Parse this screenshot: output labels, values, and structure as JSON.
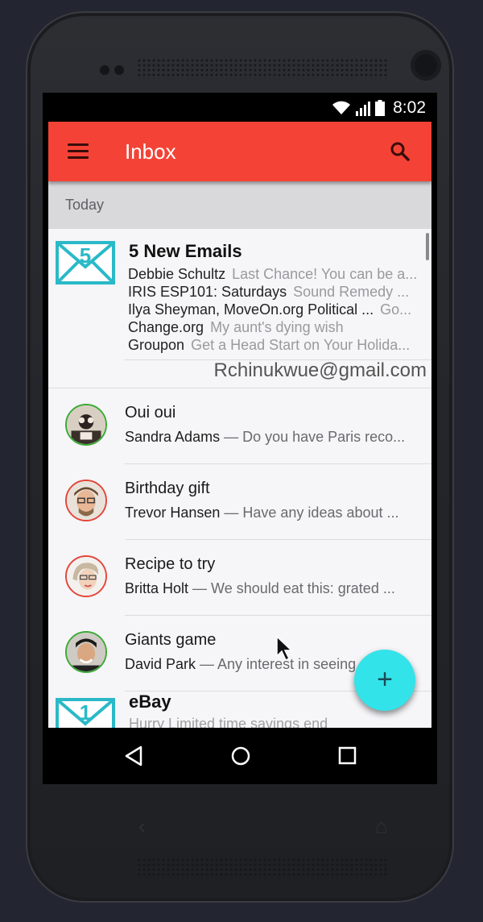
{
  "status_bar": {
    "time": "8:02"
  },
  "app_bar": {
    "title": "Inbox",
    "menu_icon": "menu-icon",
    "search_icon": "search-icon",
    "color": "#f44336"
  },
  "section": {
    "label": "Today"
  },
  "bundle": {
    "count": "5",
    "title": "5 New Emails",
    "lines": [
      {
        "from": "Debbie Schultz",
        "snippet": "Last Chance! You can be a..."
      },
      {
        "from": "IRIS ESP101: Saturdays",
        "snippet": "Sound Remedy ..."
      },
      {
        "from": "Ilya Sheyman, MoveOn.org Political ...",
        "snippet": "Go..."
      },
      {
        "from": "Change.org",
        "snippet": "My aunt's dying wish"
      },
      {
        "from": "Groupon",
        "snippet": "Get a Head Start on Your Holida..."
      }
    ],
    "account": "Rchinukwue@gmail.com"
  },
  "emails": [
    {
      "subject": "Oui oui",
      "sender": "Sandra Adams",
      "snippet": " — Do you have Paris reco..."
    },
    {
      "subject": "Birthday gift",
      "sender": "Trevor Hansen",
      "snippet": " — Have any ideas about ..."
    },
    {
      "subject": "Recipe to try",
      "sender": "Britta Holt",
      "snippet": " — We should eat this: grated ..."
    },
    {
      "subject": "Giants game",
      "sender": "David Park",
      "snippet": " — Any interest in seeing..."
    }
  ],
  "ebay": {
    "count": "1",
    "title": "eBay",
    "snippet": "Hurry Limited time savings end"
  },
  "fab": {
    "label": "+",
    "color": "#32e3ea"
  },
  "nav": {
    "back_icon": "back-triangle-icon",
    "home_icon": "home-circle-icon",
    "recents_icon": "recents-square-icon"
  }
}
